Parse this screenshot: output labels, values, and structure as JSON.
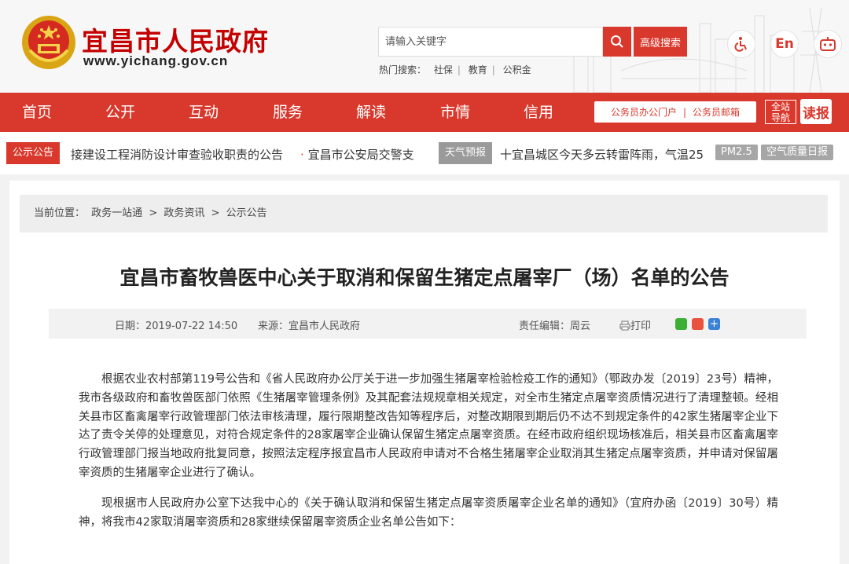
{
  "header": {
    "site_name": "宜昌市人民政府",
    "site_url": "www.yichang.gov.cn",
    "search_placeholder": "请输入关键字",
    "advanced_search": "高级搜索",
    "hot_label": "热门搜索：",
    "hot_items": [
      "社保",
      "教育",
      "公积金"
    ],
    "lang_label": "En"
  },
  "nav": {
    "items": [
      "首页",
      "公开",
      "互动",
      "服务",
      "解读",
      "市情",
      "信用"
    ],
    "portal": "公务员办公门户",
    "mail": "公务员邮箱",
    "quick": [
      "全站",
      "导航"
    ],
    "read": "读报"
  },
  "ticker": {
    "notice_tag": "公示公告",
    "notice_text": "接建设工程消防设计审查验收职责的公告",
    "notice_text2": "宜昌市公安局交警支",
    "weather_tag": "天气预报",
    "weather_text": "十宜昌城区今天多云转雷阵雨，气温25",
    "pm": "PM2.5",
    "aqi": "空气质量日报"
  },
  "article": {
    "breadcrumb": {
      "label": "当前位置：",
      "items": [
        "政务一站通",
        ">",
        "政务资讯",
        ">",
        "公示公告"
      ]
    },
    "title": "宜昌市畜牧兽医中心关于取消和保留生猪定点屠宰厂（场）名单的公告",
    "date": "日期：2019-07-22 14:50",
    "source": "来源：宜昌市人民政府",
    "editor": "责任编辑：周云",
    "print": "打印",
    "paragraphs": [
      "根据农业农村部第119号公告和《省人民政府办公厅关于进一步加强生猪屠宰检验检疫工作的通知》（鄂政办发〔2019〕23号）精神，我市各级政府和畜牧兽医部门依照《生猪屠宰管理条例》及其配套法规规章相关规定，对全市生猪定点屠宰资质情况进行了清理整顿。经相关县市区畜禽屠宰行政管理部门依法审核清理，履行限期整改告知等程序后，对整改期限到期后仍不达不到规定条件的42家生猪屠宰企业下达了责令关停的处理意见，对符合规定条件的28家屠宰企业确认保留生猪定点屠宰资质。在经市政府组织现场核准后，相关县市区畜禽屠宰行政管理部门报当地政府批复同意，按照法定程序报宜昌市人民政府申请对不合格生猪屠宰企业取消其生猪定点屠宰资质，并申请对保留屠宰资质的生猪屠宰企业进行了确认。",
      "现根据市人民政府办公室下达我中心的《关于确认取消和保留生猪定点屠宰资质屠宰企业名单的通知》（宜府办函〔2019〕30号）精神，将我市42家取消屠宰资质和28家继续保留屠宰资质企业名单公告如下："
    ]
  },
  "colors": {
    "brand_red": "#d9382c"
  }
}
